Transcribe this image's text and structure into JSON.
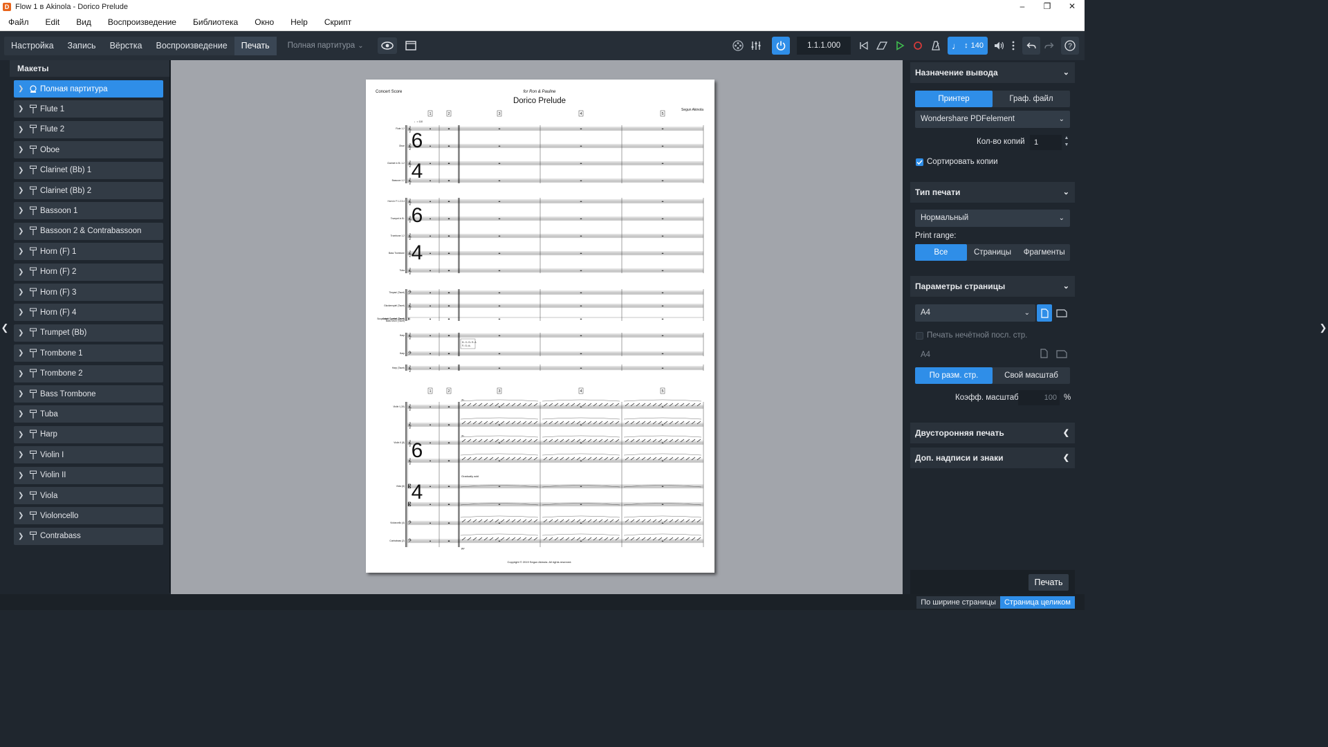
{
  "window": {
    "title": "Flow 1 в Akinola - Dorico Prelude",
    "app_icon_letter": "D",
    "controls": [
      "–",
      "❐",
      "✕"
    ]
  },
  "menu": [
    "Файл",
    "Edit",
    "Вид",
    "Воспроизведение",
    "Библиотека",
    "Окно",
    "Help",
    "Скрипт"
  ],
  "toolbar": {
    "modes": [
      "Настройка",
      "Запись",
      "Вёрстка",
      "Воспроизведение",
      "Печать"
    ],
    "active_mode": "Печать",
    "layout_select": "Полная партитура",
    "position": "1.1.1.000",
    "tempo": "140"
  },
  "left_panel": {
    "title": "Макеты",
    "items": [
      "Полная партитура",
      "Flute 1",
      "Flute 2",
      "Oboe",
      "Clarinet (Bb) 1",
      "Clarinet (Bb) 2",
      "Bassoon 1",
      "Bassoon 2 & Contrabassoon",
      "Horn (F) 1",
      "Horn (F) 2",
      "Horn (F) 3",
      "Horn (F) 4",
      "Trumpet (Bb)",
      "Trombone 1",
      "Trombone 2",
      "Bass Trombone",
      "Tuba",
      "Harp",
      "Violin I",
      "Violin II",
      "Viola",
      "Violoncello",
      "Contrabass"
    ]
  },
  "score": {
    "header_left": "Concert Score",
    "dedication": "for Ron & Pauline",
    "title": "Dorico Prelude",
    "composer": "Segun Akinola",
    "copyright": "Copyright © 2019 Segun Akinola. All rights reserved.",
    "bar_numbers": [
      "1",
      "2",
      "3",
      "4",
      "5"
    ],
    "tempo_mark": "♩= 110",
    "time_signature_top": "6",
    "time_signature_bottom": "4",
    "instruments_winds": [
      "Flute 1.2",
      "Oboe",
      "Clarinet in B♭ 1.2",
      "Bassoon 1.2"
    ],
    "instruments_brass": [
      "Horn in F 1.2.3.4",
      "Trumpet in B♭",
      "Trombone 1.2",
      "Bass Trombone",
      "Tuba"
    ],
    "instruments_perc": [
      "Timpani (Tacet)",
      "Glockenspiel (Tacet)",
      "Crash Cymbal (Tacet)"
    ],
    "perc_extra": [
      "Suspended Cymbal (Tacet)",
      "Bass Drum (Tacet)"
    ],
    "instruments_harp": [
      "Harp",
      "Harp (Tacet)"
    ],
    "harp_chord": [
      "D♭ C♭ D♭ E♭ A",
      "F♭ G♭ A♭"
    ],
    "instruments_strings": [
      "Violin I (10)",
      "Violin II (8)",
      "Viola (6)",
      "Violoncello (4)",
      "Contrabass (2)"
    ],
    "strings_marks": [
      "div.",
      "div.",
      "Gradually add",
      "pp"
    ]
  },
  "right_panel": {
    "output": {
      "title": "Назначение вывода",
      "tabs": [
        "Принтер",
        "Граф. файл"
      ],
      "active": "Принтер",
      "printer": "Wondershare PDFelement",
      "copies_label": "Кол-во копий",
      "copies": "1",
      "collate_label": "Сортировать копии"
    },
    "print_type": {
      "title": "Тип печати",
      "value": "Нормальный",
      "range_label": "Print range:",
      "range_tabs": [
        "Все",
        "Страницы",
        "Фрагменты"
      ],
      "active": "Все"
    },
    "page_setup": {
      "title": "Параметры страницы",
      "paper": "A4",
      "odd_label": "Печать нечётной посл. стр.",
      "paper2": "A4",
      "scale_tabs": [
        "По разм. стр.",
        "Свой масштаб"
      ],
      "active_scale": "По разм. стр.",
      "scale_label": "Коэфф. масштаб.",
      "scale_value": "100",
      "scale_unit": "%"
    },
    "duplex_title": "Двусторонняя печать",
    "annotations_title": "Доп. надписи и знаки",
    "print_button": "Печать"
  },
  "statusbar": {
    "view_options": [
      "По ширине страницы",
      "Страница целиком"
    ],
    "active": "Страница целиком"
  },
  "colors": {
    "accent": "#2f8ee8",
    "panel": "#1f262e",
    "canvas": "#a2a5ab"
  }
}
